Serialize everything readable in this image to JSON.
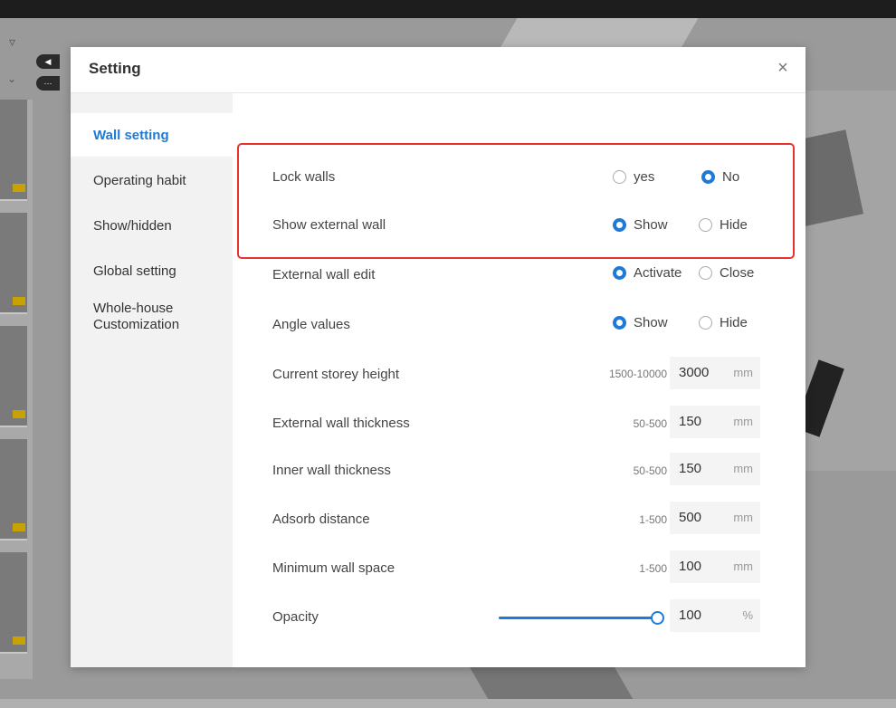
{
  "dialog": {
    "title": "Setting",
    "close_symbol": "×"
  },
  "sidebar": {
    "items": [
      {
        "label": "Wall setting"
      },
      {
        "label": "Operating habit"
      },
      {
        "label": "Show/hidden"
      },
      {
        "label": "Global setting"
      },
      {
        "label": "Whole-house\nCustomization"
      }
    ],
    "active_index": 0
  },
  "settings": {
    "lock_walls": {
      "label": "Lock walls",
      "options": [
        "yes",
        "No"
      ],
      "selected": "No"
    },
    "show_external_wall": {
      "label": "Show external wall",
      "options": [
        "Show",
        "Hide"
      ],
      "selected": "Show"
    },
    "external_wall_edit": {
      "label": "External wall edit",
      "options": [
        "Activate",
        "Close"
      ],
      "selected": "Activate"
    },
    "angle_values": {
      "label": "Angle values",
      "options": [
        "Show",
        "Hide"
      ],
      "selected": "Show"
    },
    "storey_height": {
      "label": "Current storey height",
      "range": "1500-10000",
      "value": "3000",
      "unit": "mm"
    },
    "external_thickness": {
      "label": "External wall thickness",
      "range": "50-500",
      "value": "150",
      "unit": "mm"
    },
    "inner_thickness": {
      "label": "Inner wall thickness",
      "range": "50-500",
      "value": "150",
      "unit": "mm"
    },
    "adsorb_distance": {
      "label": "Adsorb distance",
      "range": "1-500",
      "value": "500",
      "unit": "mm"
    },
    "min_wall_space": {
      "label": "Minimum wall space",
      "range": "1-500",
      "value": "100",
      "unit": "mm"
    },
    "opacity": {
      "label": "Opacity",
      "value": "100",
      "unit": "%",
      "level_percent": 100
    }
  },
  "colors": {
    "accent": "#1e7ad6",
    "highlight": "#e8322e"
  },
  "icons": {
    "filter": "filter-icon",
    "chevron": "chevron-down-icon",
    "close": "close-icon"
  }
}
